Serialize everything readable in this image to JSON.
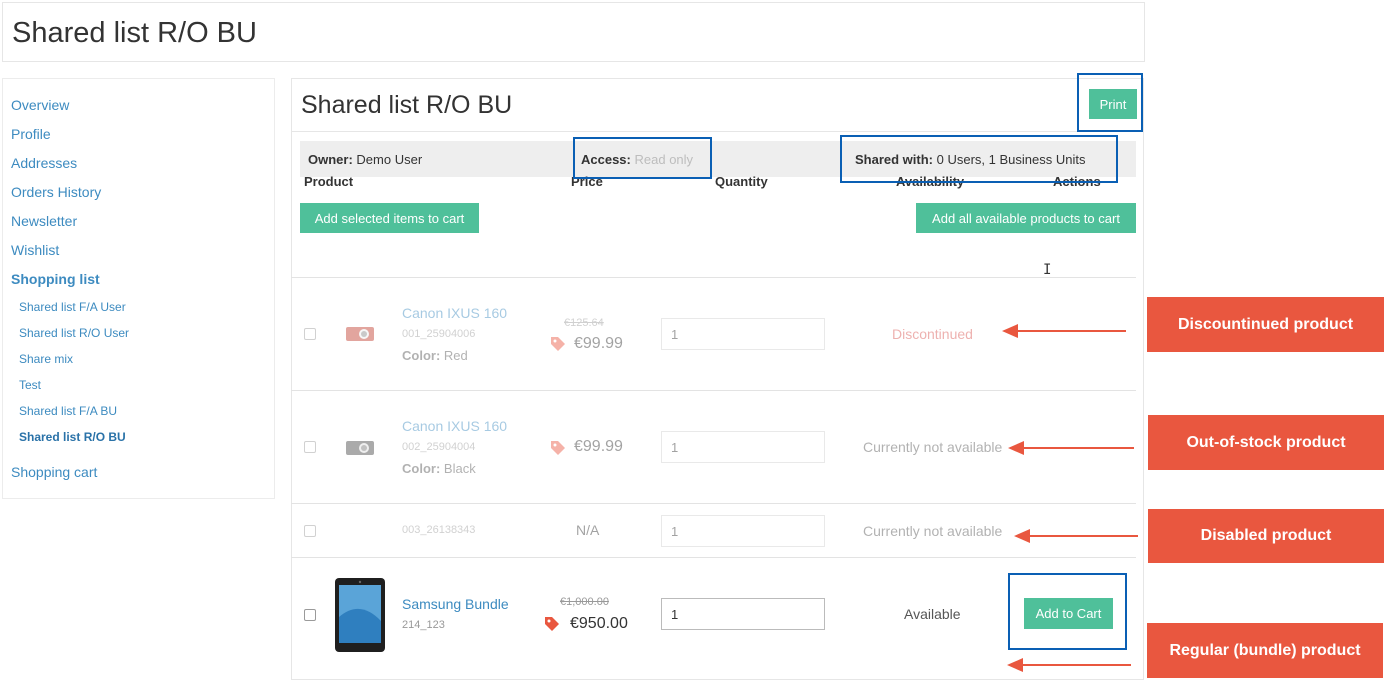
{
  "page": {
    "title": "Shared list R/O BU"
  },
  "sidebar": {
    "items": [
      {
        "label": "Overview"
      },
      {
        "label": "Profile"
      },
      {
        "label": "Addresses"
      },
      {
        "label": "Orders History"
      },
      {
        "label": "Newsletter"
      },
      {
        "label": "Wishlist"
      },
      {
        "label": "Shopping list"
      }
    ],
    "sub_items": [
      {
        "label": "Shared list F/A User"
      },
      {
        "label": "Shared list R/O User"
      },
      {
        "label": "Share mix"
      },
      {
        "label": "Test"
      },
      {
        "label": "Shared list F/A BU"
      },
      {
        "label": "Shared list R/O BU",
        "active": true
      }
    ],
    "cart_label": "Shopping cart"
  },
  "main": {
    "title": "Shared list R/O BU",
    "print_label": "Print",
    "owner": {
      "label": "Owner:",
      "value": "Demo User"
    },
    "access": {
      "label": "Access:",
      "value": "Read only"
    },
    "shared": {
      "label": "Shared with:",
      "value": "0 Users, 1 Business Units"
    },
    "add_selected_label": "Add selected items to cart",
    "add_all_label": "Add all available products to cart",
    "columns": [
      "Product",
      "Price",
      "Quantity",
      "Availability",
      "Actions"
    ]
  },
  "rows": [
    {
      "name": "Canon IXUS 160",
      "sku": "001_25904006",
      "attr_label": "Color:",
      "attr_value": "Red",
      "old_price": "€125.64",
      "price": "€99.99",
      "qty": "1",
      "availability": "Discontinued",
      "status": "discontinued"
    },
    {
      "name": "Canon IXUS 160",
      "sku": "002_25904004",
      "attr_label": "Color:",
      "attr_value": "Black",
      "old_price": "",
      "price": "€99.99",
      "qty": "1",
      "availability": "Currently not available",
      "status": "out-of-stock"
    },
    {
      "name": "",
      "sku": "003_26138343",
      "price": "N/A",
      "qty": "1",
      "availability": "Currently not available",
      "status": "disabled"
    },
    {
      "name": "Samsung Bundle",
      "sku": "214_123",
      "old_price": "€1,000.00",
      "price": "€950.00",
      "qty": "1",
      "availability": "Available",
      "action_label": "Add to Cart",
      "status": "available"
    }
  ],
  "callouts": [
    {
      "label": "Discountinued product"
    },
    {
      "label": "Out-of-stock product"
    },
    {
      "label": "Disabled product"
    },
    {
      "label": "Regular (bundle) product"
    }
  ],
  "colors": {
    "accent_green": "#4fc09a",
    "link_blue": "#3d8bc0",
    "highlight_blue": "#0a5fb4",
    "callout_red": "#e9573f",
    "discontinued_red": "#d9534f"
  }
}
